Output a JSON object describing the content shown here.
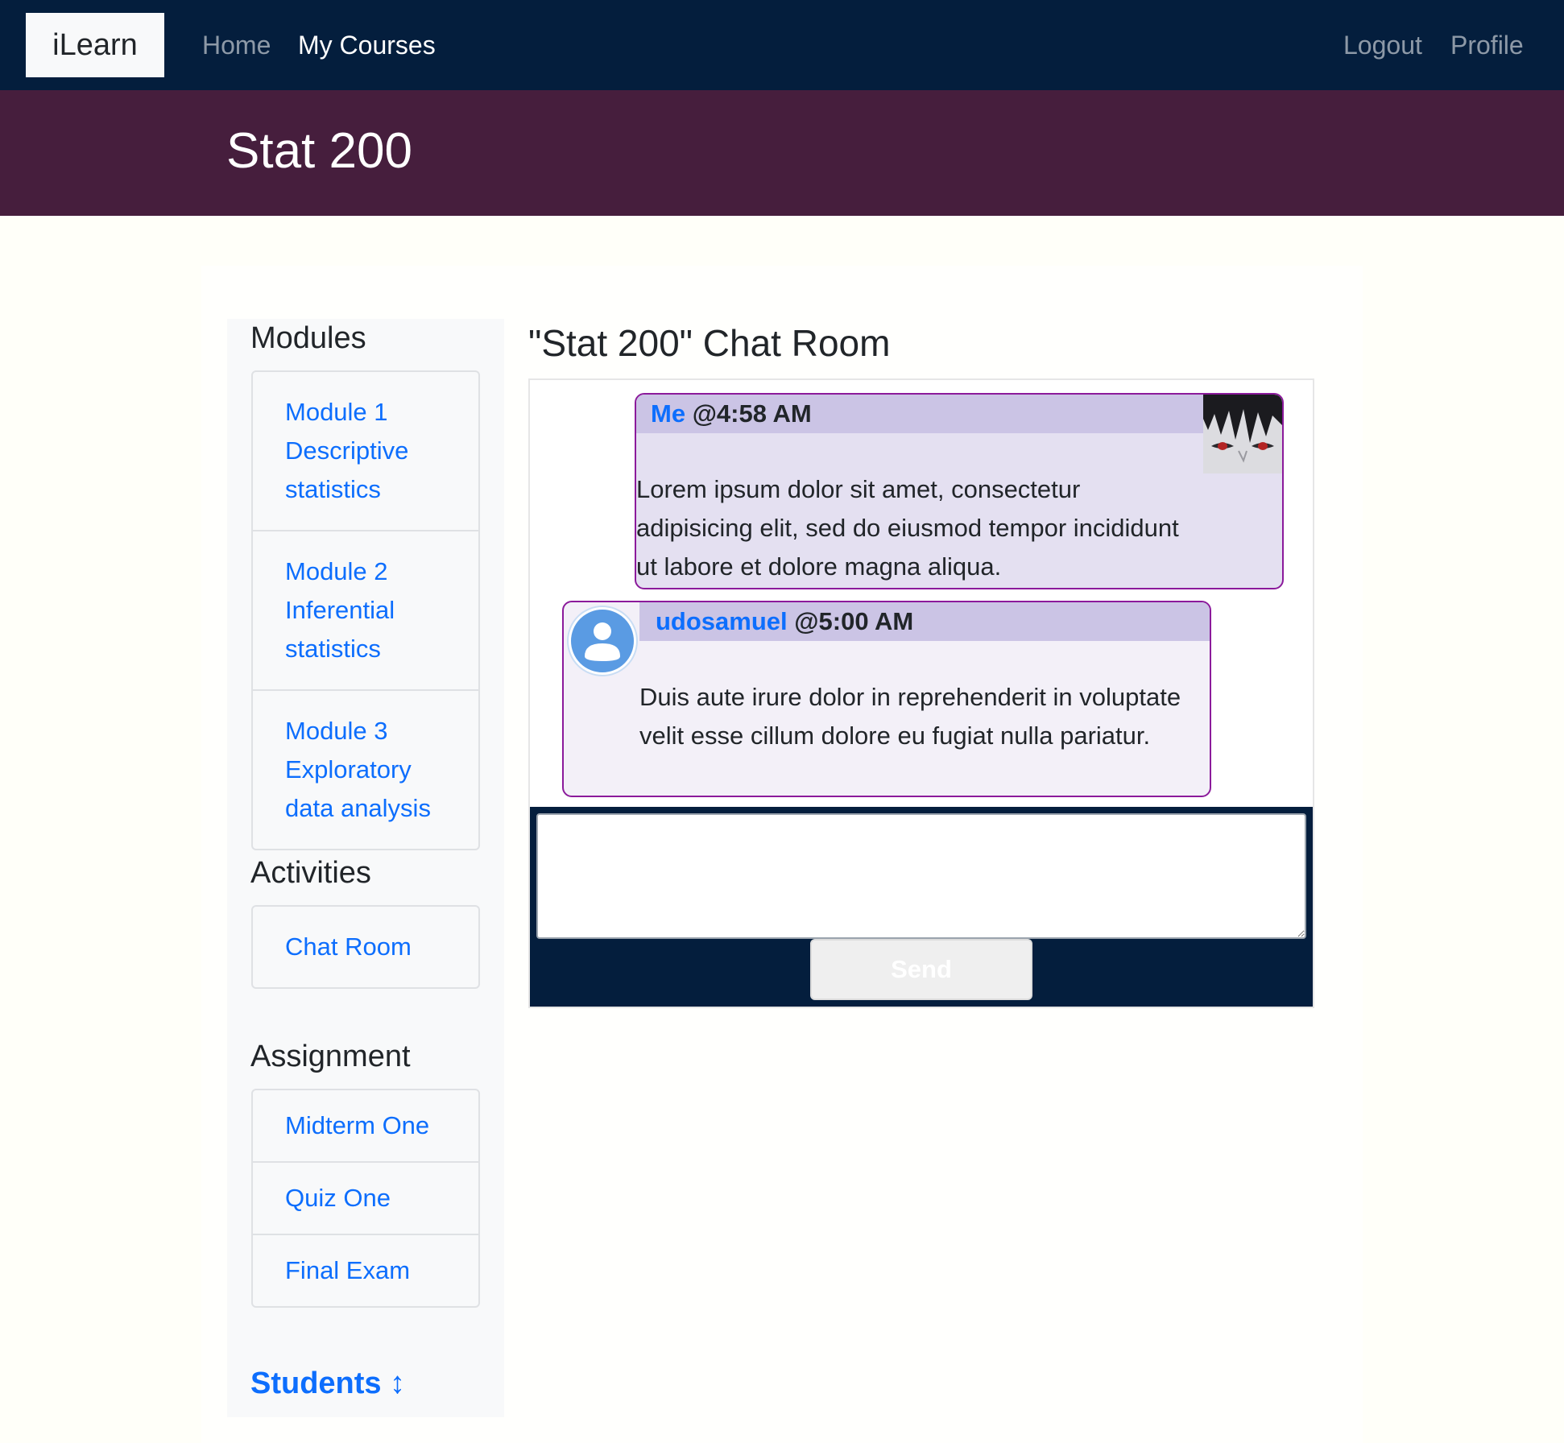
{
  "navbar": {
    "brand": "iLearn",
    "links": [
      {
        "label": "Home",
        "active": false
      },
      {
        "label": "My Courses",
        "active": true
      }
    ],
    "right_links": [
      {
        "label": "Logout"
      },
      {
        "label": "Profile"
      }
    ]
  },
  "course": {
    "title": "Stat 200"
  },
  "sidebar": {
    "modules_heading": "Modules",
    "modules": [
      {
        "label": "Module 1 Descriptive statistics"
      },
      {
        "label": "Module 2 Inferential statistics"
      },
      {
        "label": "Module 3 Exploratory data analysis"
      }
    ],
    "activities_heading": "Activities",
    "activities": [
      {
        "label": "Chat Room"
      }
    ],
    "assignment_heading": "Assignment",
    "assignments": [
      {
        "label": "Midterm One"
      },
      {
        "label": "Quiz One"
      },
      {
        "label": "Final Exam"
      }
    ],
    "students_label": "Students",
    "students_arrow": "↕"
  },
  "chat": {
    "title": "\"Stat 200\" Chat Room",
    "messages": [
      {
        "author": "Me",
        "time": "@4:58 AM",
        "text": "Lorem ipsum dolor sit amet, consectetur adipisicing elit, sed do eiusmod tempor incididunt ut labore et dolore magna aliqua.",
        "avatar": "profile-photo"
      },
      {
        "author": "udosamuel",
        "time": "@5:00 AM",
        "text": "Duis aute irure dolor in reprehenderit in voluptate velit esse cillum dolore eu fugiat nulla pariatur.",
        "avatar": "default-user-icon"
      }
    ],
    "input_placeholder": "",
    "send_label": "Send"
  },
  "colors": {
    "navbar_bg": "#041e3d",
    "banner_bg": "#461e3d",
    "link": "#0d6efd",
    "message_border": "#8b1a9b",
    "message_header_bg": "#cbc4e5"
  }
}
